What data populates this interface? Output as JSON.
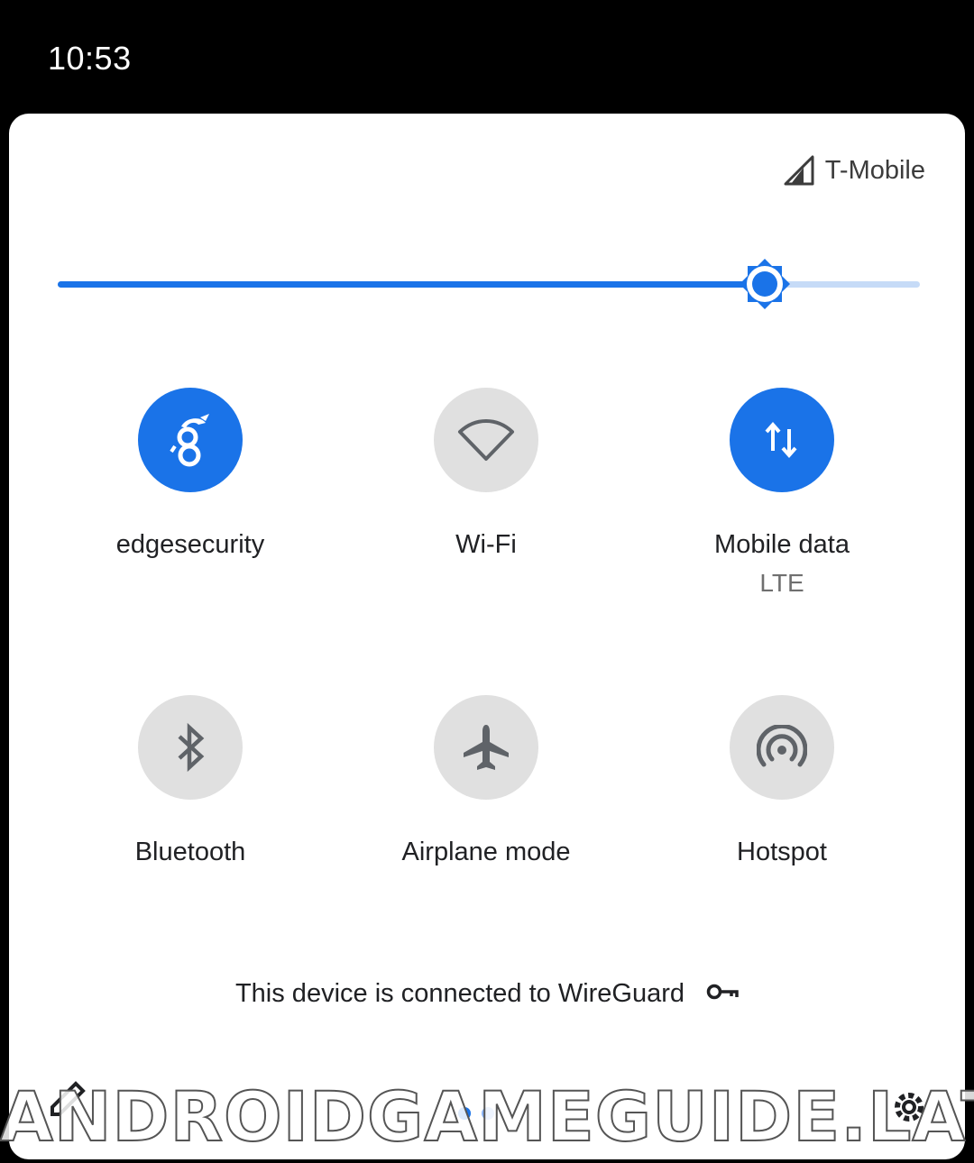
{
  "status_bar": {
    "time": "10:53"
  },
  "carrier": {
    "name": "T-Mobile",
    "icon": "signal-icon"
  },
  "brightness": {
    "level": 0.82,
    "icon": "brightness-icon"
  },
  "tiles": [
    {
      "label": "edgesecurity",
      "sublabel": "",
      "icon": "wireguard-icon",
      "active": true
    },
    {
      "label": "Wi-Fi",
      "sublabel": "",
      "icon": "wifi-icon",
      "active": false
    },
    {
      "label": "Mobile data",
      "sublabel": "LTE",
      "icon": "mobile-data-icon",
      "active": true
    },
    {
      "label": "Bluetooth",
      "sublabel": "",
      "icon": "bluetooth-icon",
      "active": false
    },
    {
      "label": "Airplane mode",
      "sublabel": "",
      "icon": "airplane-icon",
      "active": false
    },
    {
      "label": "Hotspot",
      "sublabel": "",
      "icon": "hotspot-icon",
      "active": false
    }
  ],
  "footer": {
    "vpn_text": "This device is connected to WireGuard",
    "icon": "vpn-key-icon"
  },
  "bottom": {
    "edit_icon": "edit-icon",
    "settings_icon": "settings-icon",
    "pages": 2,
    "current_page": 1
  },
  "watermark": "ANDROIDGAMEGUIDE.LAT",
  "colors": {
    "accent": "#1a73e8",
    "tile_off": "#e0e0e0",
    "track": "#c6dbf7"
  }
}
